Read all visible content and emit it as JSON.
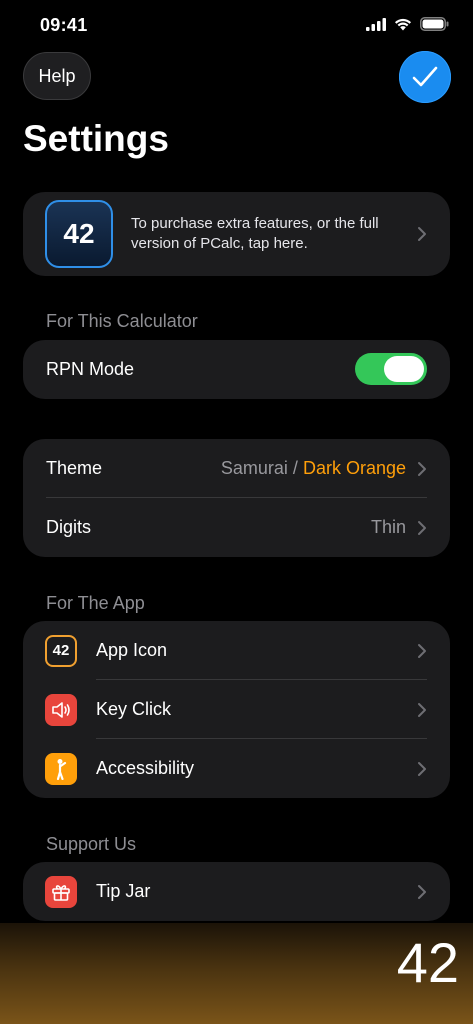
{
  "status": {
    "time": "09:41"
  },
  "nav": {
    "help_label": "Help",
    "title": "Settings"
  },
  "promo": {
    "icon_text": "42",
    "text": "To purchase extra features, or the full version of PCalc, tap here."
  },
  "calc_section": {
    "header": "For This Calculator",
    "rpn_label": "RPN Mode",
    "rpn_on": true
  },
  "display_section": {
    "theme_label": "Theme",
    "theme_value": "Samurai /",
    "theme_accent": "Dark Orange",
    "digits_label": "Digits",
    "digits_value": "Thin"
  },
  "app_section": {
    "header": "For The App",
    "items": [
      {
        "label": "App Icon",
        "icon": "app-icon-42",
        "icon_text": "42"
      },
      {
        "label": "Key Click",
        "icon": "speaker-icon"
      },
      {
        "label": "Accessibility",
        "icon": "accessibility-icon"
      }
    ]
  },
  "support_section": {
    "header": "Support Us",
    "items": [
      {
        "label": "Tip Jar",
        "icon": "gift-icon"
      }
    ]
  },
  "calculator": {
    "display": "42"
  },
  "colors": {
    "accent_blue": "#1a8cf0",
    "toggle_green": "#34c759",
    "orange": "#ff9f0a",
    "red": "#e8453c"
  }
}
